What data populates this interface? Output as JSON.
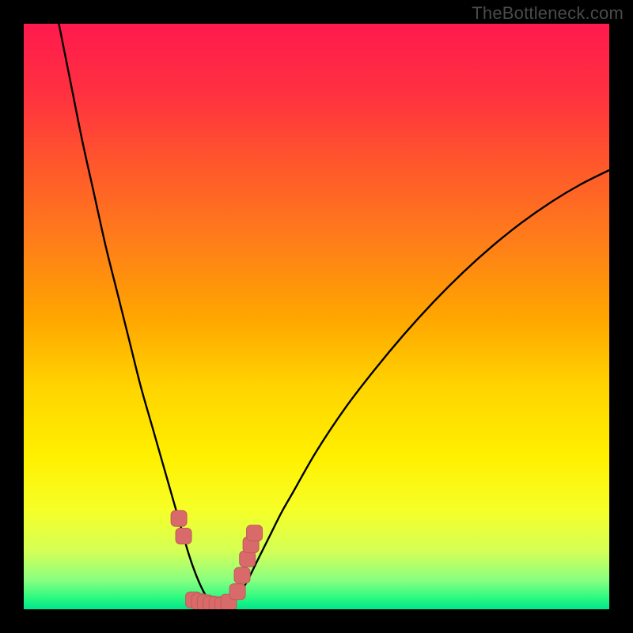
{
  "watermark": "TheBottleneck.com",
  "colors": {
    "frame_bg": "#000000",
    "curve": "#000000",
    "marker_fill": "#d86a6a",
    "marker_stroke": "#c25a5a"
  },
  "chart_data": {
    "type": "line",
    "title": "",
    "xlabel": "",
    "ylabel": "",
    "xlim": [
      0,
      100
    ],
    "ylim": [
      0,
      100
    ],
    "grid": false,
    "series": [
      {
        "name": "bottleneck-curve",
        "x": [
          6,
          8,
          10,
          12,
          14,
          16,
          18,
          20,
          22,
          24,
          25,
          26,
          27,
          28,
          29,
          30,
          31,
          32,
          33,
          34,
          35,
          36,
          38,
          40,
          42,
          44,
          46,
          50,
          55,
          60,
          65,
          70,
          75,
          80,
          85,
          90,
          95,
          100
        ],
        "values": [
          100,
          90,
          80,
          71,
          62,
          54,
          46,
          38,
          31,
          24,
          20.5,
          17,
          13.5,
          10,
          7,
          4.5,
          2.5,
          1.2,
          0.6,
          0.4,
          0.7,
          1.5,
          4.5,
          8.5,
          12.5,
          16.5,
          20,
          27,
          34.5,
          41,
          47,
          52.5,
          57.5,
          62,
          66,
          69.5,
          72.5,
          75
        ]
      }
    ],
    "markers": [
      {
        "x": 26.5,
        "y": 15.5
      },
      {
        "x": 27.3,
        "y": 12.5
      },
      {
        "x": 29.0,
        "y": 1.6
      },
      {
        "x": 30.0,
        "y": 1.3
      },
      {
        "x": 31.0,
        "y": 1.1
      },
      {
        "x": 32.0,
        "y": 0.9
      },
      {
        "x": 33.0,
        "y": 0.8
      },
      {
        "x": 34.0,
        "y": 0.7
      },
      {
        "x": 35.0,
        "y": 1.2
      },
      {
        "x": 36.5,
        "y": 3.0
      },
      {
        "x": 37.3,
        "y": 5.8
      },
      {
        "x": 38.2,
        "y": 8.6
      },
      {
        "x": 38.8,
        "y": 11.0
      },
      {
        "x": 39.4,
        "y": 13.0
      }
    ]
  }
}
